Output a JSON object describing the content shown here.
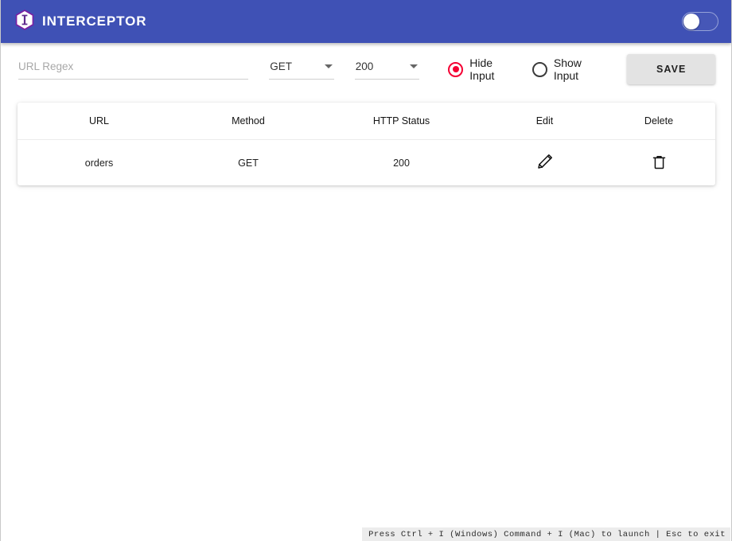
{
  "app": {
    "brand_title": "INTERCEPTOR",
    "logo_icon": "hexagon-i-logo-icon",
    "accent_color": "#3f51b5",
    "toggle": {
      "name": "interceptor-enable-toggle",
      "state": "off"
    }
  },
  "form": {
    "url_regex": {
      "value": "",
      "placeholder": "URL Regex"
    },
    "method_select": {
      "value": "GET",
      "caret_icon": "chevron-down-icon"
    },
    "status_select": {
      "value": "200",
      "caret_icon": "chevron-down-icon"
    },
    "input_mode": {
      "selected": "Hide Input",
      "options": [
        {
          "label": "Hide Input",
          "checked": true
        },
        {
          "label": "Show Input",
          "checked": false
        }
      ],
      "selected_color": "#f50033"
    },
    "save_label": "SAVE"
  },
  "table": {
    "headers": {
      "url": "URL",
      "method": "Method",
      "status": "HTTP Status",
      "edit": "Edit",
      "delete": "Delete"
    },
    "rows": [
      {
        "url": "orders",
        "method": "GET",
        "status": "200",
        "edit_icon": "pencil-icon",
        "delete_icon": "trash-icon"
      }
    ]
  },
  "footer": {
    "hint": "Press Ctrl + I (Windows) Command + I (Mac) to launch | Esc to exit"
  }
}
